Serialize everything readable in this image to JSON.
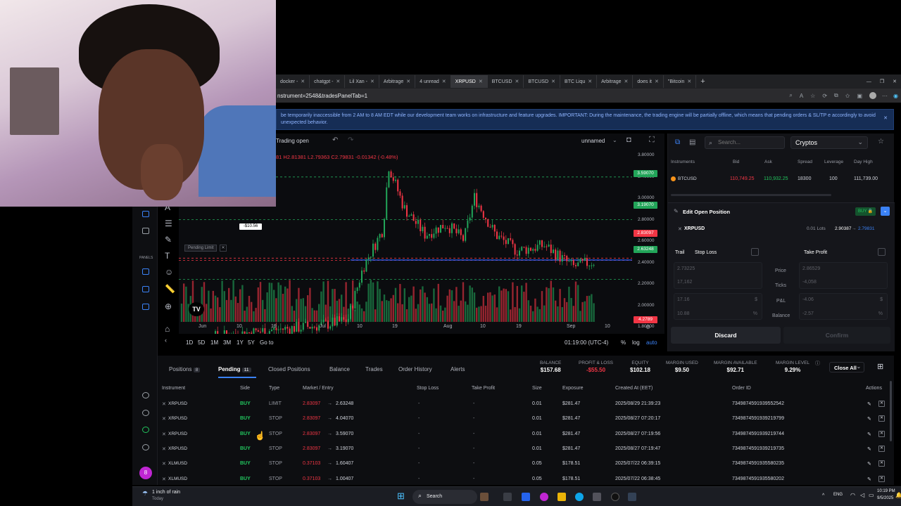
{
  "browser": {
    "tabs": [
      "docker -",
      "chatgpt -",
      "Lil Xan -",
      "Arbitrage",
      "4 unread",
      "XRPUSD",
      "BTCUSD",
      "BTCUSD",
      "BTC Liqu",
      "Arbitrage",
      "does it",
      "\"Bitcoin"
    ],
    "url_fragment": "nstrument=2548&tradesPanelTab=1"
  },
  "banner": {
    "text": "be temporarily inaccessible from 2 AM to 8 AM EDT while our development team works on infrastructure and feature upgrades. IMPORTANT: During the maintenance, the trading engine will be partially offline, which means that pending orders & SL/TP e accordingly to avoid unexpected behavior."
  },
  "chart": {
    "status": "Trading open",
    "layout_name": "unnamed",
    "ohlc": "81 H2.81381 L2.79363 C2.79831 -0.01342 (-0.48%)",
    "price_ticks": [
      "3.80000",
      "3.40000",
      "3.00000",
      "2.80000",
      "2.60000",
      "2.40000",
      "2.20000",
      "2.00000",
      "1.80000"
    ],
    "price_labels": [
      {
        "text": "3.59070",
        "color": "#22a559"
      },
      {
        "text": "3.19070",
        "color": "#22a559"
      },
      {
        "text": "2.83097",
        "color": "#f23645"
      },
      {
        "text": "2.63248",
        "color": "#22a559"
      },
      {
        "text": "4.2789",
        "color": "#f23645"
      }
    ],
    "date_ticks": [
      "Jun",
      "10",
      "19",
      "Jul",
      "10",
      "19",
      "Aug",
      "10",
      "19",
      "Sep",
      "10"
    ],
    "ranges": [
      "1D",
      "5D",
      "1M",
      "3M",
      "1Y",
      "5Y",
      "Go to"
    ],
    "clock": "01:19:00 (UTC-4)",
    "scale_opts": [
      "%",
      "log",
      "auto"
    ],
    "tag_value": "-$10.56",
    "pending_label": "Pending Limit",
    "series_up": "#22a559",
    "series_down": "#f23645"
  },
  "instruments": {
    "search_placeholder": "Search...",
    "category": "Cryptos",
    "headers": [
      "Instruments",
      "Bid",
      "Ask",
      "Spread",
      "Leverage",
      "Day High"
    ],
    "row": {
      "symbol": "BTCUSD",
      "bid": "110,749.25",
      "ask": "110,932.25",
      "spread": "18300",
      "leverage": "100",
      "day_high": "111,739.00"
    }
  },
  "edit_position": {
    "title": "Edit Open Position",
    "side_badge": "BUY",
    "symbol": "XRPUSD",
    "lots": "0.01 Lots",
    "entry": "2.90387",
    "current": "2.79831",
    "trail": "Trail",
    "stop_loss": "Stop Loss",
    "take_profit": "Take Profit",
    "sl_price": "2.73225",
    "sl_ticks": "17,162",
    "sl_pnl": "17.16",
    "sl_bal": "10.88",
    "tp_price": "2.86529",
    "tp_ticks": "-4,058",
    "tp_pnl": "-4.06",
    "tp_bal": "-2.57",
    "row_labels": [
      "Price",
      "Ticks",
      "P&L",
      "Balance"
    ],
    "currency": "$",
    "percent": "%",
    "discard": "Discard",
    "confirm": "Confirm"
  },
  "bottom": {
    "tabs": [
      {
        "label": "Positions",
        "count": "8"
      },
      {
        "label": "Pending",
        "count": "11"
      },
      {
        "label": "Closed Positions"
      },
      {
        "label": "Balance"
      },
      {
        "label": "Trades"
      },
      {
        "label": "Order History"
      },
      {
        "label": "Alerts"
      }
    ],
    "stats": [
      {
        "label": "BALANCE",
        "value": "$157.68"
      },
      {
        "label": "PROFIT & LOSS",
        "value": "-$55.50"
      },
      {
        "label": "EQUITY",
        "value": "$102.18"
      },
      {
        "label": "MARGIN USED",
        "value": "$9.50"
      },
      {
        "label": "MARGIN AVAILABLE",
        "value": "$92.71"
      },
      {
        "label": "MARGIN LEVEL",
        "value": "9.29%"
      }
    ],
    "close_all": "Close All",
    "columns": [
      "Instrument",
      "Side",
      "Type",
      "Market / Entry",
      "Stop Loss",
      "Take Profit",
      "Size",
      "Exposure",
      "Created At (EET)",
      "Order ID",
      "Actions"
    ],
    "rows": [
      {
        "symbol": "XRPUSD",
        "side": "BUY",
        "type": "LIMIT",
        "market": "2.83097",
        "entry": "2.63248",
        "sl": "-",
        "tp": "-",
        "size": "0.01",
        "exposure": "$281.47",
        "created": "2025/08/29 21:39:23",
        "order_id": "7349874591939552542"
      },
      {
        "symbol": "XRPUSD",
        "side": "BUY",
        "type": "STOP",
        "market": "2.83097",
        "entry": "4.04070",
        "sl": "-",
        "tp": "-",
        "size": "0.01",
        "exposure": "$281.47",
        "created": "2025/08/27 07:20:17",
        "order_id": "7349874591939219799"
      },
      {
        "symbol": "XRPUSD",
        "side": "BUY",
        "type": "STOP",
        "market": "2.83097",
        "entry": "3.59070",
        "sl": "-",
        "tp": "-",
        "size": "0.01",
        "exposure": "$281.47",
        "created": "2025/08/27 07:19:56",
        "order_id": "7349874591939219744"
      },
      {
        "symbol": "XRPUSD",
        "side": "BUY",
        "type": "STOP",
        "market": "2.83097",
        "entry": "3.19070",
        "sl": "-",
        "tp": "-",
        "size": "0.01",
        "exposure": "$281.47",
        "created": "2025/08/27 07:19:47",
        "order_id": "7349874591939219735"
      },
      {
        "symbol": "XLMUSD",
        "side": "BUY",
        "type": "STOP",
        "market": "0.37103",
        "entry": "1.60407",
        "sl": "-",
        "tp": "-",
        "size": "0.05",
        "exposure": "$178.51",
        "created": "2025/07/22 06:39:15",
        "order_id": "7349874591935580235"
      },
      {
        "symbol": "XLMUSD",
        "side": "BUY",
        "type": "STOP",
        "market": "0.37103",
        "entry": "1.00407",
        "sl": "-",
        "tp": "-",
        "size": "0.05",
        "exposure": "$178.51",
        "created": "2025/07/22 06:38:45",
        "order_id": "7349874591935580202"
      }
    ]
  },
  "taskbar": {
    "weather": "1 inch of rain",
    "weather_sub": "Today",
    "search": "Search",
    "lang": "ENG",
    "time": "10:19 PM",
    "date": "9/5/2025"
  },
  "colors": {
    "accent": "#3b82f6",
    "up": "#22c55e",
    "down": "#f23645"
  }
}
